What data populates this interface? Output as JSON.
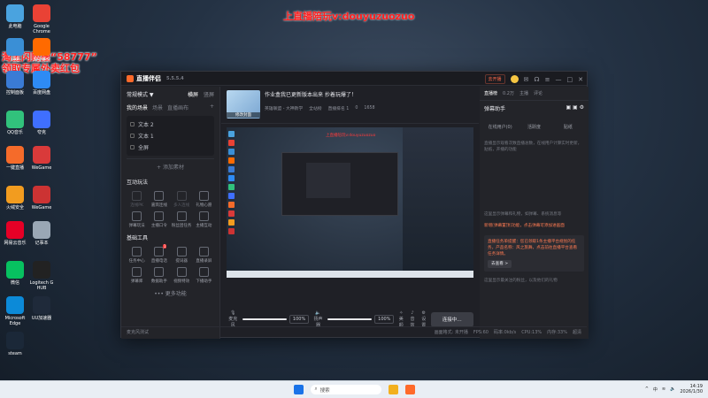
{
  "promo": {
    "top": "上直播陪玩v:douyuzuozuo",
    "left_line1": "淘宝闪购搜“58777”",
    "left_line2": "领取专属外卖红包",
    "preview_text": "上直播陪玩v:douyuzuozuo"
  },
  "desktop_icons": [
    {
      "label": "此电脑",
      "color": "#4aa3df"
    },
    {
      "label": "Google Chrome",
      "color": "#e94235"
    },
    {
      "label": "网络",
      "color": "#3a8fd6"
    },
    {
      "label": "淘宝特价",
      "color": "#ff6a00"
    },
    {
      "label": "控制面板",
      "color": "#3a7bd5"
    },
    {
      "label": "百度网盘",
      "color": "#2e8bf5"
    },
    {
      "label": "QQ音乐",
      "color": "#31c27c"
    },
    {
      "label": "夸克",
      "color": "#3f6fff"
    },
    {
      "label": "一键直播",
      "color": "#f56b2a"
    },
    {
      "label": "WeGame",
      "color": "#d93a3a"
    },
    {
      "label": "火绒安全",
      "color": "#f29c1f"
    },
    {
      "label": "WeGame",
      "color": "#c33"
    },
    {
      "label": "网易云音乐",
      "color": "#e60026"
    },
    {
      "label": "记事本",
      "color": "#9aa7b5"
    },
    {
      "label": "微信",
      "color": "#07c160"
    },
    {
      "label": "Logitech G HUB",
      "color": "#222"
    },
    {
      "label": "Microsoft Edge",
      "color": "#0c8ad8"
    },
    {
      "label": "UU加速器",
      "color": "#1f2a3a"
    },
    {
      "label": "steam",
      "color": "#1b2838"
    }
  ],
  "app": {
    "name": "直播伴侣",
    "version": "5.5.5.4",
    "live_btn": "去开播",
    "mode": "常规模式 ▼",
    "mode_tabs": [
      "横屏",
      "竖屏"
    ],
    "scene_label": "我的场景",
    "scene_tabs": [
      "我的场景",
      "场景",
      "直播画布"
    ],
    "sources": [
      "文本 2",
      "文本 1",
      "全屏"
    ],
    "add_source": "+ 添加素材",
    "interactive_title": "互动玩法",
    "interactive_items": [
      {
        "label": "连线PK",
        "dim": true
      },
      {
        "label": "嘉宾连线",
        "dim": false
      },
      {
        "label": "多人连线",
        "dim": true
      },
      {
        "label": "礼物心愿",
        "dim": false
      },
      {
        "label": "弹幕玩法",
        "dim": false
      },
      {
        "label": "主播口令",
        "dim": false
      },
      {
        "label": "粉丝团任务",
        "dim": false
      },
      {
        "label": "主播互动",
        "dim": false
      }
    ],
    "tools_title": "基础工具",
    "tools_items": [
      {
        "label": "任务中心",
        "badge": ""
      },
      {
        "label": "直播电话",
        "badge": "1"
      },
      {
        "label": "提词器",
        "badge": ""
      },
      {
        "label": "直播录屏",
        "badge": ""
      },
      {
        "label": "弹幕库",
        "badge": ""
      },
      {
        "label": "数据助手",
        "badge": ""
      },
      {
        "label": "视频特效",
        "badge": ""
      },
      {
        "label": "下播助手",
        "badge": ""
      }
    ],
    "more_features": "••• 更多功能",
    "room_title": "作业盒我已更新版本出来 抄着玩爆了！",
    "room_category": "英雄联盟 - 大神教学",
    "room_meta": [
      "全站榜",
      "直播排名 1",
      "0",
      "1658"
    ],
    "room_actions": [
      "开播指导",
      "分享"
    ],
    "cover_label": "修改封面",
    "mic_label": "麦克风",
    "mic_pct": "100%",
    "speaker_label": "扬声器",
    "speaker_pct": "100%",
    "ctrl_labels": [
      "美颜",
      "音效",
      "设置"
    ],
    "go_live": "连接中…",
    "status": [
      "麦克风测试",
      "画面格式: 未开播",
      "FPS:60",
      "码率:0kb/s",
      "CPU:13%",
      "内存:33%",
      "超清"
    ],
    "right_tabs": [
      "直播榜",
      "0.2万",
      "主播",
      "评论"
    ],
    "right_sub": "弹幕助手",
    "right_seg": [
      "在线用户(0)",
      "活跃度",
      "贴纸"
    ],
    "right_note1": "直播显示观看次数直播总数，在线用户计算实时更新，贴纸，开播的功能",
    "right_note2": "这里显示弹幕和礼物，如弹幕、系统消息等",
    "right_warn": "新增[弹幕置顶]功能，点击弹幕可添加进画面",
    "right_box": "直播任务单提醒：您已领取1条主播平台规划的任务，产品名称：风之旅舞，点击前往直播平台查看任务详情。",
    "right_box_btn": "去查看 >",
    "right_note3": "这里显示最关注的粉丝，以及他们的礼物"
  },
  "taskbar": {
    "search_placeholder": "搜索",
    "time": "14:19",
    "date": "2026/1/30",
    "lang": "中"
  }
}
